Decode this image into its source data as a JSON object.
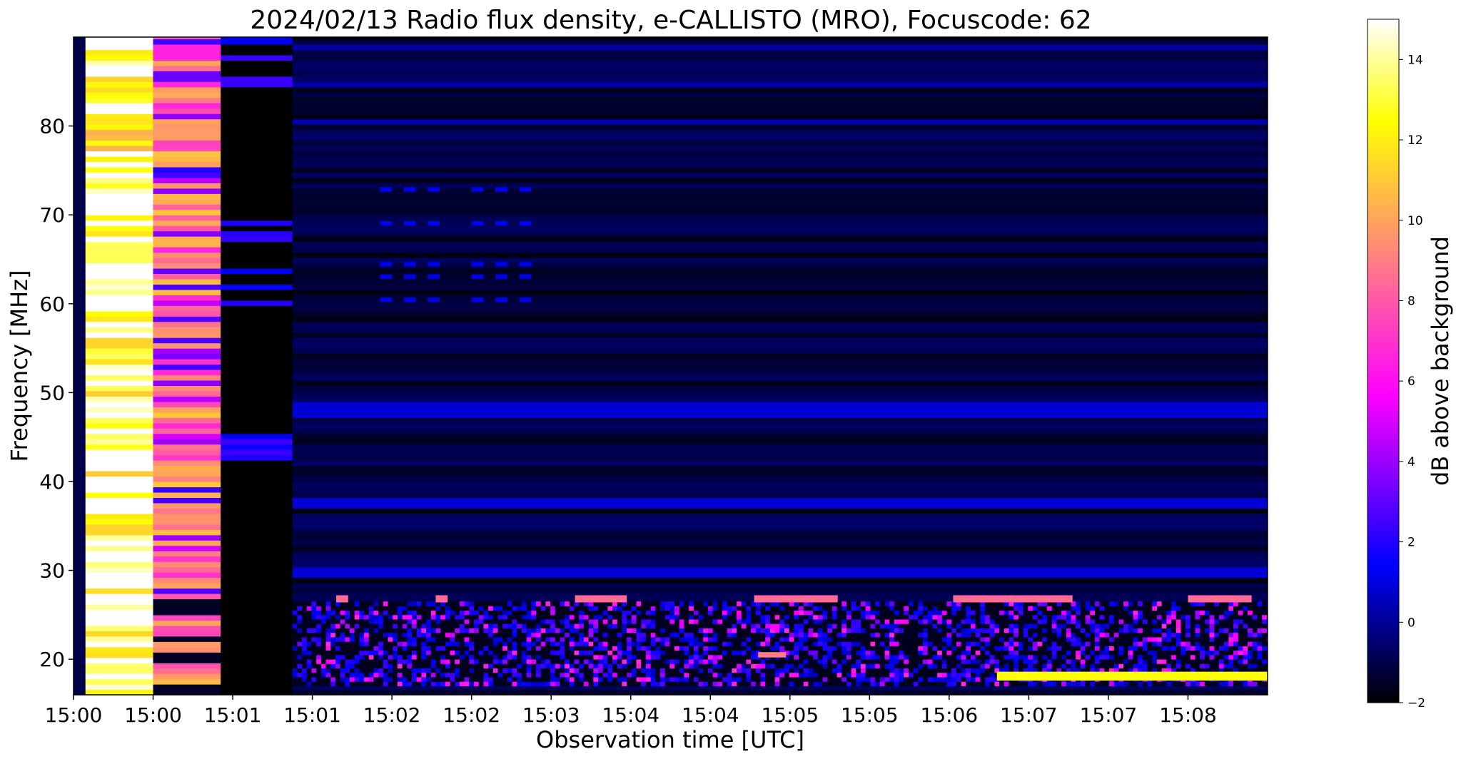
{
  "chart_data": {
    "type": "heatmap",
    "title": "2024/02/13  Radio flux density, e-CALLISTO (MRO), Focuscode: 62",
    "xlabel": "Observation time [UTC]",
    "ylabel": "Frequency [MHz]",
    "colorbar_label": "dB above background",
    "xlim": [
      0,
      15
    ],
    "ylim": [
      16,
      90
    ],
    "x_ticks": [
      {
        "value": 0,
        "label": "15:00"
      },
      {
        "value": 1,
        "label": "15:00"
      },
      {
        "value": 2,
        "label": "15:01"
      },
      {
        "value": 3,
        "label": "15:01"
      },
      {
        "value": 4,
        "label": "15:02"
      },
      {
        "value": 5,
        "label": "15:02"
      },
      {
        "value": 6,
        "label": "15:03"
      },
      {
        "value": 7,
        "label": "15:04"
      },
      {
        "value": 8,
        "label": "15:04"
      },
      {
        "value": 9,
        "label": "15:05"
      },
      {
        "value": 10,
        "label": "15:05"
      },
      {
        "value": 11,
        "label": "15:06"
      },
      {
        "value": 12,
        "label": "15:07"
      },
      {
        "value": 13,
        "label": "15:07"
      },
      {
        "value": 14,
        "label": "15:08"
      }
    ],
    "y_ticks": [
      20,
      30,
      40,
      50,
      60,
      70,
      80
    ],
    "colorbar": {
      "range": [
        -2,
        15
      ],
      "ticks": [
        -2,
        0,
        2,
        4,
        6,
        8,
        10,
        12,
        14
      ],
      "colormap": [
        "#000000",
        "#0000ff",
        "#ff00ff",
        "#ff8080",
        "#ffff00",
        "#ffffff"
      ]
    },
    "regions": [
      {
        "x": [
          0.15,
          1.0
        ],
        "level": 14.5,
        "note": "white/yellow saturated block"
      },
      {
        "x": [
          1.0,
          1.85
        ],
        "level": 8.5,
        "note": "pink/orange block"
      },
      {
        "x": [
          1.85,
          2.75
        ],
        "level": -2,
        "note": "dark block"
      },
      {
        "x": [
          2.75,
          15
        ],
        "level": 0,
        "note": "quiet background with interference band 17-27 MHz"
      }
    ]
  }
}
